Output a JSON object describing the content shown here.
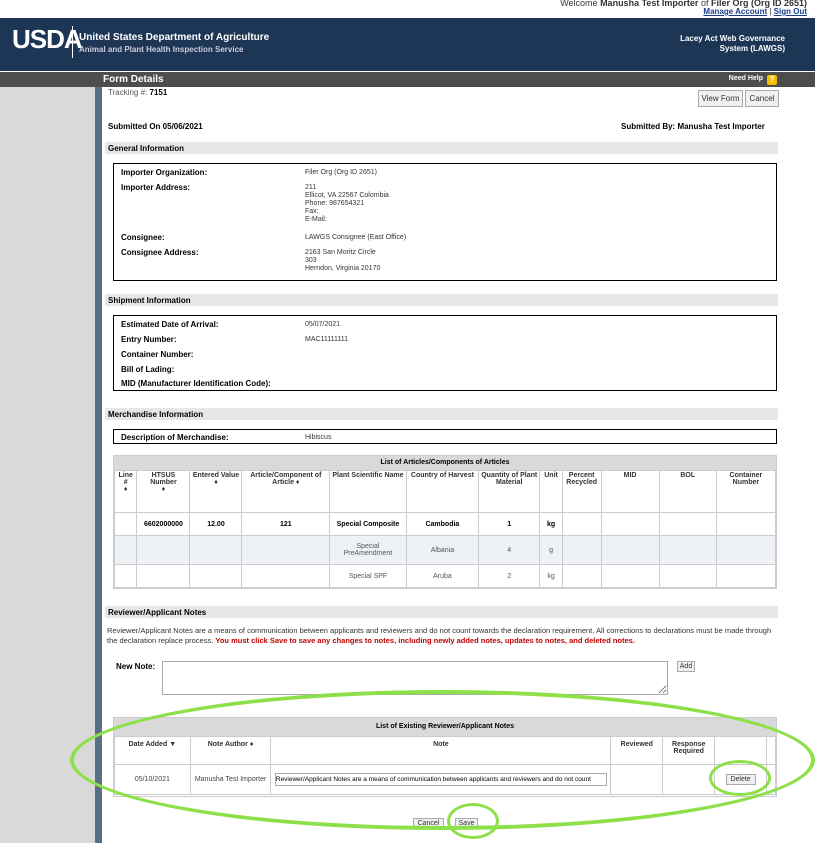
{
  "topbar": {
    "welcome_prefix": "Welcome",
    "user": "Manusha Test Importer",
    "of_text": "of",
    "org": "Filer Org (Org ID 2651)",
    "manage_account": "Manage Account",
    "separator": "|",
    "sign_out": "Sign Out"
  },
  "header": {
    "logo": "USDA",
    "agency": "United States Department of Agriculture",
    "sub_agency": "Animal and Plant Health Inspection Service",
    "system_line1": "Lacey Act Web Governance",
    "system_line2": "System (LAWGS)"
  },
  "formbar": {
    "title": "Form Details",
    "help": "Need Help",
    "help_icon": "question-icon"
  },
  "tracking": {
    "label": "Tracking #:",
    "value": "7151"
  },
  "actions": {
    "view_form": "View Form",
    "cancel": "Cancel"
  },
  "submitted_on": "Submitted On 05/06/2021",
  "submitted_by": "Submitted By: Manusha Test Importer",
  "general": {
    "title": "General Information",
    "importer_org_label": "Importer Organization:",
    "importer_org": "Filer Org (Org ID 2651)",
    "importer_addr_label": "Importer Address:",
    "importer_addr": [
      "211",
      "Ellicot, VA 22567 Colombia",
      "Phone: 987654321",
      "Fax:",
      "E-Mail:"
    ],
    "consignee_label": "Consignee:",
    "consignee": "LAWGS Consignee (East Office)",
    "consignee_addr_label": "Consignee Address:",
    "consignee_addr": [
      "2163 San Moritz Circle",
      "303",
      "Herndon, Virginia 20170"
    ]
  },
  "shipment": {
    "title": "Shipment Information",
    "eta_label": "Estimated Date of Arrival:",
    "eta": "05/07/2021",
    "entry_label": "Entry Number:",
    "entry": "MAC11111111",
    "container_label": "Container Number:",
    "bol_label": "Bill of Lading:",
    "mid_label": "MID (Manufacturer Identification Code):"
  },
  "merch": {
    "title": "Merchandise Information",
    "desc_label": "Description of Merchandise:",
    "desc": "Hibiscus"
  },
  "articles": {
    "title": "List of Articles/Components of Articles",
    "headers": [
      "Line #",
      "HTSUS Number",
      "Entered Value",
      "Article/Component of Article",
      "Plant Scientific Name",
      "Country of Harvest",
      "Quantity of Plant Material",
      "Unit",
      "Percent Recycled",
      "MID",
      "BOL",
      "Container Number"
    ],
    "sort_icon": "♦",
    "rows": [
      [
        "",
        "6602000000",
        "12.00",
        "121",
        "Special Composite",
        "Cambodia",
        "1",
        "kg",
        "",
        "",
        "",
        ""
      ],
      [
        "",
        "",
        "",
        "",
        "Special PreAmendment",
        "Albania",
        "4",
        "g",
        "",
        "",
        "",
        ""
      ],
      [
        "",
        "",
        "",
        "",
        "Special SPF",
        "Aruba",
        "2",
        "kg",
        "",
        "",
        "",
        ""
      ]
    ]
  },
  "notes": {
    "title": "Reviewer/Applicant Notes",
    "desc": "Reviewer/Applicant Notes are a means of communication between applicants and reviewers and do not count towards the declaration requirement. All corrections to declarations must be made through the declaration replace process.",
    "warning": "You must click Save to save any changes to notes, including newly added notes, updates to notes, and deleted notes.",
    "new_note_label": "New Note:",
    "add": "Add",
    "list_title": "List of Existing Reviewer/Applicant Notes",
    "headers": [
      "Date Added",
      "Note Author",
      "Note",
      "Reviewed",
      "Response Required"
    ],
    "row": {
      "date": "05/10/2021",
      "author": "Manusha Test Importer",
      "note": "Reviewer/Applicant Notes are a means of communication between applicants and reviewers and do not count",
      "delete": "Delete"
    },
    "cancel": "Cancel",
    "save": "Save"
  }
}
